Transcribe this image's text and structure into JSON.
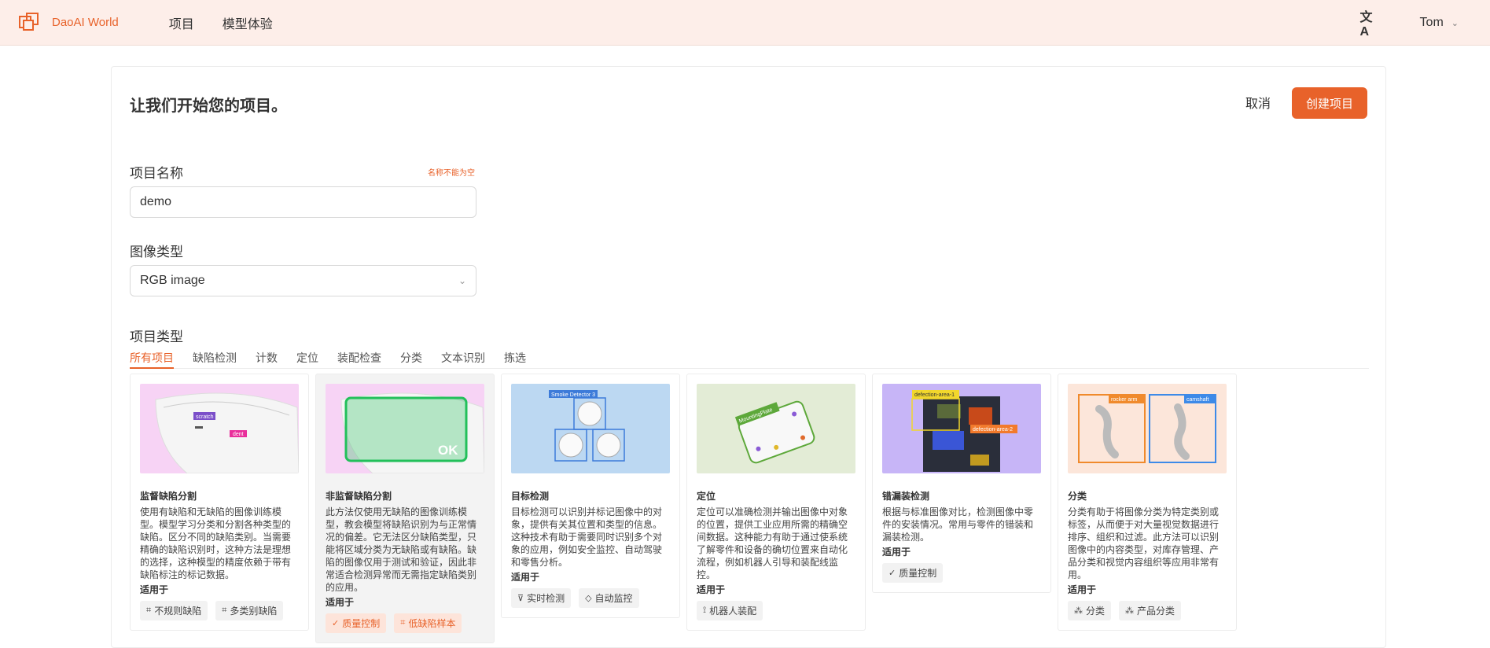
{
  "header": {
    "brand": "DaoAI World",
    "nav": [
      "项目",
      "模型体验"
    ],
    "user": "Tom"
  },
  "form": {
    "heading": "让我们开始您的项目。",
    "cancel_label": "取消",
    "create_label": "创建项目",
    "name_label": "项目名称",
    "name_error": "名称不能为空",
    "name_value": "demo",
    "image_type_label": "图像类型",
    "image_type_value": "RGB image",
    "project_type_label": "项目类型"
  },
  "tabs": [
    "所有项目",
    "缺陷检测",
    "计数",
    "定位",
    "装配检查",
    "分类",
    "文本识别",
    "拣选"
  ],
  "cards": [
    {
      "title": "监督缺陷分割",
      "desc": "使用有缺陷和无缺陷的图像训练模型。模型学习分类和分割各种类型的缺陷。区分不同的缺陷类别。当需要精确的缺陷识别时，这种方法是理想的选择，这种模型的精度依赖于带有缺陷标注的标记数据。",
      "apply": "适用于",
      "tags": [
        "不规则缺陷",
        "多类别缺陷"
      ],
      "thumb_labels": [
        "scratch",
        "dent"
      ]
    },
    {
      "title": "非监督缺陷分割",
      "desc": "此方法仅使用无缺陷的图像训练模型，教会模型将缺陷识别为与正常情况的偏差。它无法区分缺陷类型，只能将区域分类为无缺陷或有缺陷。缺陷的图像仅用于测试和验证，因此非常适合检测异常而无需指定缺陷类别的应用。",
      "apply": "适用于",
      "tags": [
        "质量控制",
        "低缺陷样本"
      ],
      "thumb_labels": [
        "OK"
      ]
    },
    {
      "title": "目标检测",
      "desc": "目标检测可以识别并标记图像中的对象，提供有关其位置和类型的信息。这种技术有助于需要同时识别多个对象的应用，例如安全监控、自动驾驶和零售分析。",
      "apply": "适用于",
      "tags": [
        "实时检测",
        "自动监控"
      ],
      "thumb_labels": [
        "Smoke Detector 3"
      ]
    },
    {
      "title": "定位",
      "desc": "定位可以准确检测并输出图像中对象的位置，提供工业应用所需的精确空间数据。这种能力有助于通过使系统了解零件和设备的确切位置来自动化流程，例如机器人引导和装配线监控。",
      "apply": "适用于",
      "tags": [
        "机器人装配"
      ],
      "thumb_labels": [
        "MountingPlate"
      ]
    },
    {
      "title": "错漏装检测",
      "desc": "根据与标准图像对比，检测图像中零件的安装情况。常用与零件的错装和漏装检测。",
      "apply": "适用于",
      "tags": [
        "质量控制"
      ],
      "thumb_labels": [
        "defection-area-1",
        "defection-area-2"
      ]
    },
    {
      "title": "分类",
      "desc": "分类有助于将图像分类为特定类别或标签，从而便于对大量视觉数据进行排序、组织和过滤。此方法可以识别图像中的内容类型，对库存管理、产品分类和视觉内容组织等应用非常有用。",
      "apply": "适用于",
      "tags": [
        "分类",
        "产品分类"
      ],
      "thumb_labels": [
        "rocker arm",
        "camshaft"
      ]
    }
  ]
}
